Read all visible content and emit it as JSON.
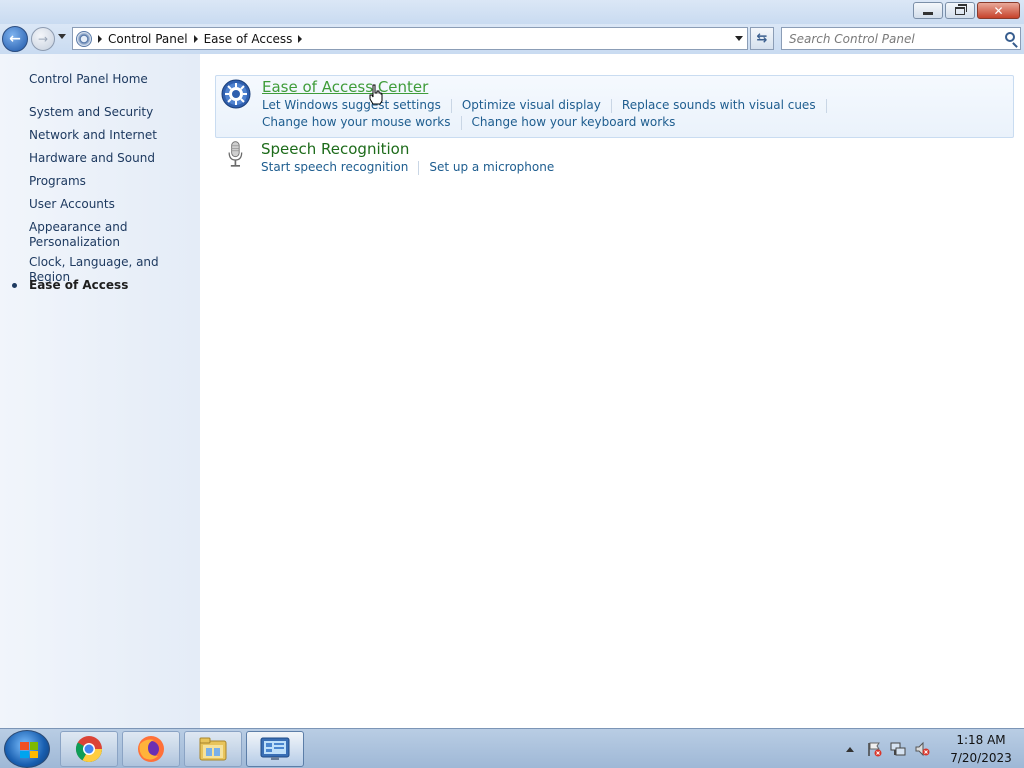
{
  "window": {
    "minimize_icon": "minimize-icon",
    "maximize_icon": "restore-icon",
    "close_icon": "close-icon"
  },
  "navigation": {
    "breadcrumbs": [
      "Control Panel",
      "Ease of Access"
    ],
    "search_placeholder": "Search Control Panel"
  },
  "sidebar": {
    "home": "Control Panel Home",
    "items": [
      {
        "label": "System and Security"
      },
      {
        "label": "Network and Internet"
      },
      {
        "label": "Hardware and Sound"
      },
      {
        "label": "Programs"
      },
      {
        "label": "User Accounts"
      },
      {
        "label": "Appearance and Personalization"
      },
      {
        "label": "Clock, Language, and Region"
      },
      {
        "label": "Ease of Access",
        "active": true
      }
    ]
  },
  "categories": [
    {
      "title": "Ease of Access Center",
      "icon": "ease-of-access-icon",
      "links_row1": [
        "Let Windows suggest settings",
        "Optimize visual display",
        "Replace sounds with visual cues"
      ],
      "links_row2": [
        "Change how your mouse works",
        "Change how your keyboard works"
      ]
    },
    {
      "title": "Speech Recognition",
      "icon": "microphone-icon",
      "links_row1": [
        "Start speech recognition",
        "Set up a microphone"
      ]
    }
  ],
  "taskbar": {
    "apps": [
      "chrome-icon",
      "firefox-icon",
      "file-explorer-icon",
      "control-panel-icon"
    ],
    "time": "1:18 AM",
    "date": "7/20/2023"
  },
  "colors": {
    "category_title": "#1d6b1a",
    "link": "#1e5d8f",
    "sidebar_bg": "#e4ecf7"
  }
}
